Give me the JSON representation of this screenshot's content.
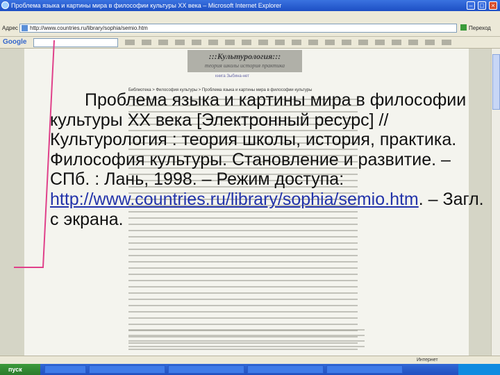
{
  "window": {
    "title": "Проблема языка и картины мира в философии культуры XX века – Microsoft Internet Explorer"
  },
  "toolbar": {
    "address_label": "Адрес",
    "address_value": "http://www.countries.ru/library/sophia/semio.htm",
    "go_label": "Переход"
  },
  "google_bar": {
    "logo": "Google"
  },
  "page": {
    "banner_title": ":::Культурология:::",
    "banner_subtitle": "теория школы история практика",
    "mid_link": "книга Зыбина-нет",
    "breadcrumb": "Библиотека > Философия культуры > Проблема языка и картины мира в философии культуры"
  },
  "overlay": {
    "citation_text": "Проблема языка и картины мира в философии культуры XX века [Электронный ресурс] // Культурология : теория школы, история, практика. Философия культуры. Становление и развитие. – СПб. : Лань, 1998. – Режим доступа:",
    "citation_url": "http://www.countries.ru/library/sophia/semio.htm",
    "citation_tail": ". – Загл. с экрана."
  },
  "statusbar": {
    "zone": "Интернет"
  },
  "taskbar": {
    "start_label": "пуск"
  }
}
